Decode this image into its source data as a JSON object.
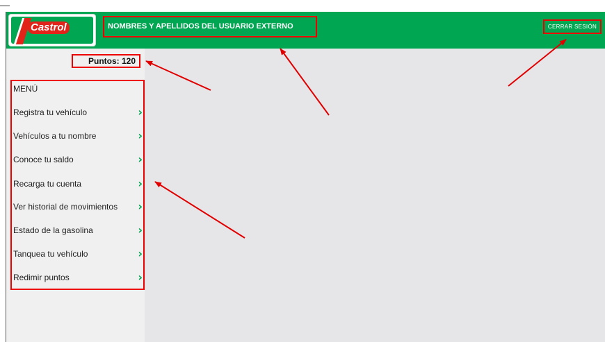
{
  "header": {
    "logo_text": "Castrol",
    "user_name": "NOMBRES Y APELLIDOS DEL USUARIO EXTERNO",
    "logout_label": "CERRAR SESIÓN"
  },
  "sidebar": {
    "points": "Puntos: 120",
    "menu_title": "MENÚ",
    "items": [
      {
        "label": "Registra tu vehículo"
      },
      {
        "label": "Vehículos a tu nombre"
      },
      {
        "label": "Conoce tu saldo"
      },
      {
        "label": "Recarga tu cuenta"
      },
      {
        "label": "Ver historial de movimientos"
      },
      {
        "label": "Estado de la gasolina"
      },
      {
        "label": "Tanquea tu vehículo"
      },
      {
        "label": "Redimir puntos"
      }
    ],
    "chevron": "›"
  },
  "colors": {
    "brand_green": "#00a651",
    "annotation_red": "#e00000",
    "content_bg": "#e6e6e9",
    "sidebar_bg": "#f0f0f0"
  },
  "icons": {
    "menu_item": "chevron-right-icon"
  }
}
